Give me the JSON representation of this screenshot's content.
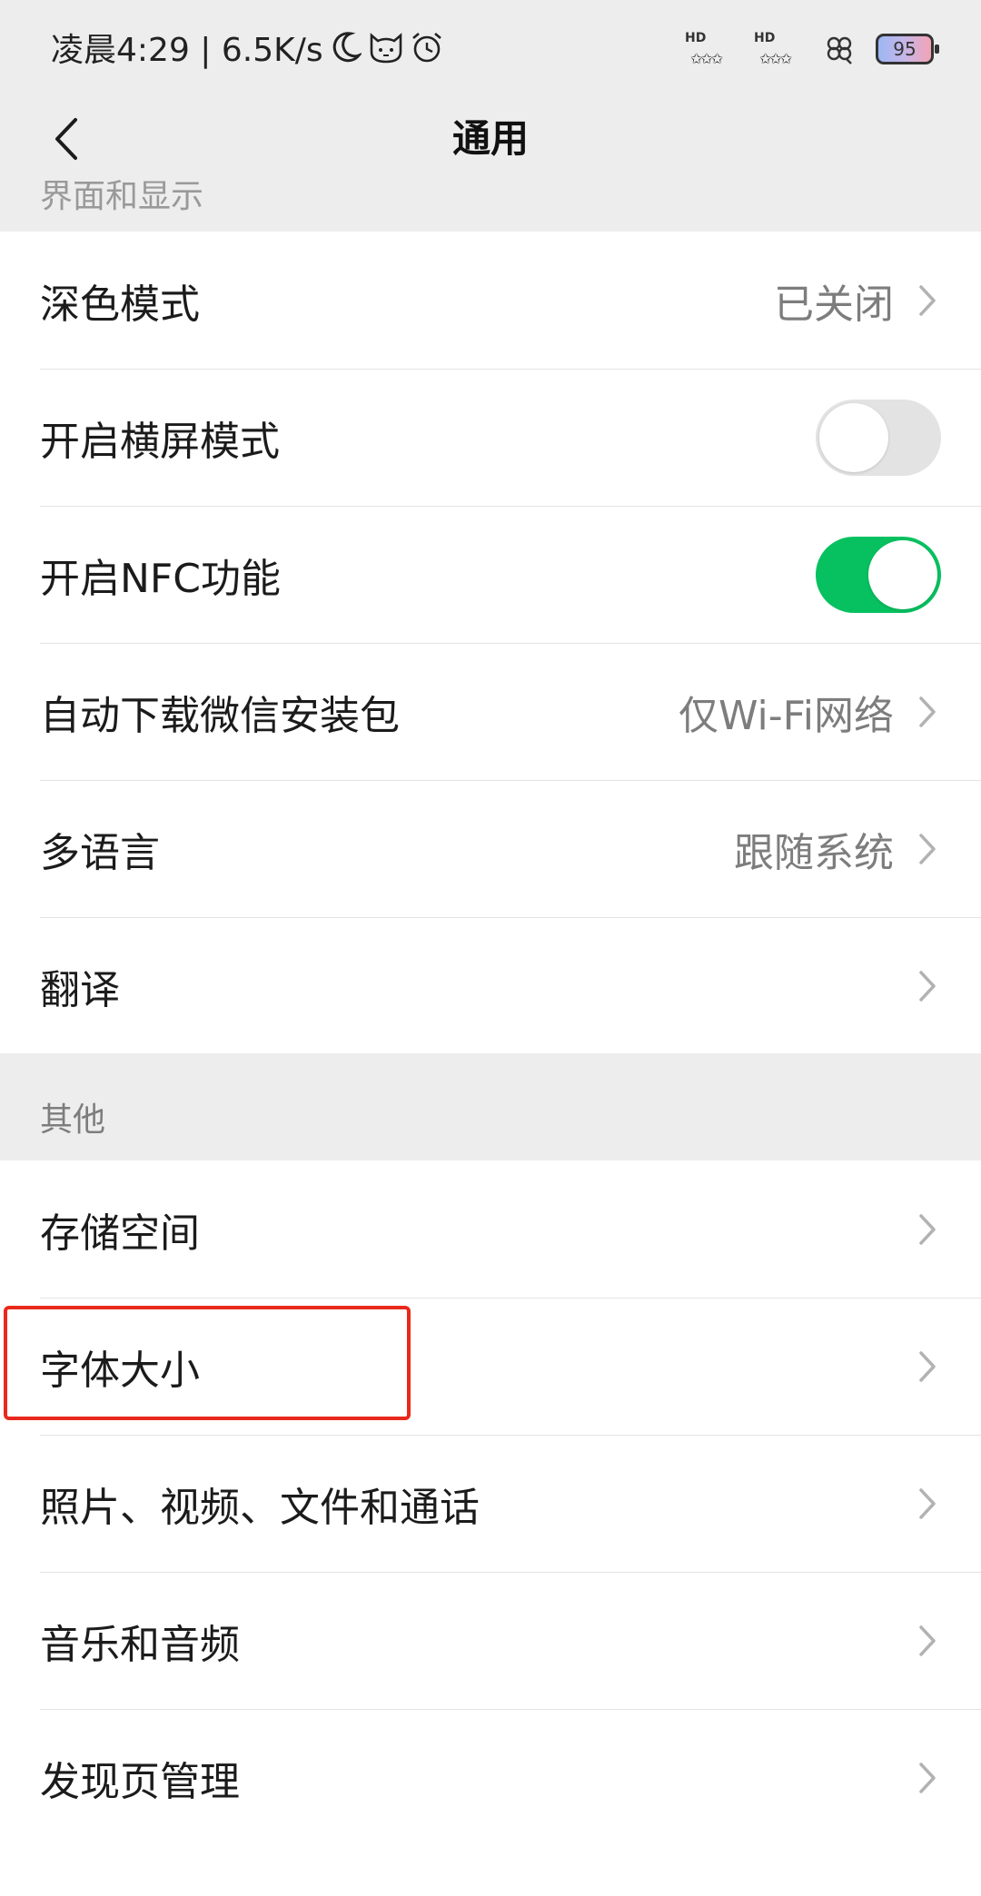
{
  "status_bar": {
    "time_speed": "凌晨4:29 | 6.5K/s",
    "hd1": "HD",
    "hd2": "HD",
    "battery": "95"
  },
  "nav": {
    "title": "通用",
    "cut_section_header": "界面和显示"
  },
  "display_settings": [
    {
      "label": "深色模式",
      "value": "已关闭"
    },
    {
      "label": "开启横屏模式",
      "toggle": "off"
    },
    {
      "label": "开启NFC功能",
      "toggle": "on"
    },
    {
      "label": "自动下载微信安装包",
      "value": "仅Wi-Fi网络"
    },
    {
      "label": "多语言",
      "value": "跟随系统"
    },
    {
      "label": "翻译"
    }
  ],
  "other": {
    "header": "其他",
    "items": [
      {
        "label": "存储空间"
      },
      {
        "label": "字体大小"
      },
      {
        "label": "照片、视频、文件和通话"
      },
      {
        "label": "音乐和音频"
      },
      {
        "label": "发现页管理"
      }
    ]
  },
  "colors": {
    "accent_green": "#07c160",
    "highlight_red": "#e8291c",
    "page_background": "#ededed"
  }
}
